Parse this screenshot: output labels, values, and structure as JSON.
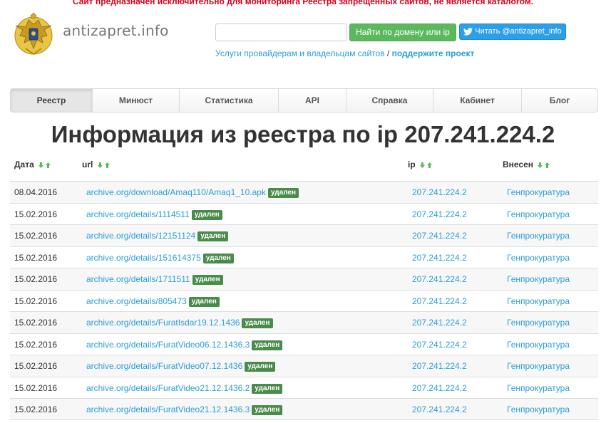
{
  "header": {
    "notice": "Сайт предназначен исключительно для мониторинга Реестра запрещенных сайтов, не является каталогом.",
    "site_name": "antizapret.info",
    "search_placeholder": "",
    "search_button": "Найти по домену или ip",
    "twitter_button": "Читать @antizapret_info",
    "services_link": "Услуги провайдерам и владельцам сайтов",
    "separator": " / ",
    "support_link": "поддержите проект"
  },
  "nav": {
    "tabs": [
      {
        "label": "Реестр",
        "active": true
      },
      {
        "label": "Минюст",
        "active": false
      },
      {
        "label": "Статистика",
        "active": false
      },
      {
        "label": "API",
        "active": false
      },
      {
        "label": "Справка",
        "active": false
      },
      {
        "label": "Кабинет",
        "active": false
      },
      {
        "label": "Блог",
        "active": false
      }
    ]
  },
  "page": {
    "title": "Информация из реестра по ip ",
    "ip": "207.241.224.2"
  },
  "table": {
    "headers": {
      "date": "Дата",
      "url": "url",
      "ip": "ip",
      "added_by": "Внесен"
    },
    "status_label": "удален",
    "rows": [
      {
        "date": "08.04.2016",
        "url": "archive.org/download/Amaq110/Amaq1_10.apk",
        "ip": "207.241.224.2",
        "added_by": "Генпрокуратура"
      },
      {
        "date": "15.02.2016",
        "url": "archive.org/details/1114511",
        "ip": "207.241.224.2",
        "added_by": "Генпрокуратура"
      },
      {
        "date": "15.02.2016",
        "url": "archive.org/details/12151124",
        "ip": "207.241.224.2",
        "added_by": "Генпрокуратура"
      },
      {
        "date": "15.02.2016",
        "url": "archive.org/details/151614375",
        "ip": "207.241.224.2",
        "added_by": "Генпрокуратура"
      },
      {
        "date": "15.02.2016",
        "url": "archive.org/details/1711511",
        "ip": "207.241.224.2",
        "added_by": "Генпрокуратура"
      },
      {
        "date": "15.02.2016",
        "url": "archive.org/details/805473",
        "ip": "207.241.224.2",
        "added_by": "Генпрокуратура"
      },
      {
        "date": "15.02.2016",
        "url": "archive.org/details/FuratIsdar19.12.1436",
        "ip": "207.241.224.2",
        "added_by": "Генпрокуратура"
      },
      {
        "date": "15.02.2016",
        "url": "archive.org/details/FuratVideo06.12.1436.3",
        "ip": "207.241.224.2",
        "added_by": "Генпрокуратура"
      },
      {
        "date": "15.02.2016",
        "url": "archive.org/details/FuratVideo07.12.1436",
        "ip": "207.241.224.2",
        "added_by": "Генпрокуратура"
      },
      {
        "date": "15.02.2016",
        "url": "archive.org/details/FuratVideo21.12.1436.2",
        "ip": "207.241.224.2",
        "added_by": "Генпрокуратура"
      },
      {
        "date": "15.02.2016",
        "url": "archive.org/details/FuratVideo21.12.1436.3",
        "ip": "207.241.224.2",
        "added_by": "Генпрокуратура"
      }
    ]
  },
  "colors": {
    "accent_green": "#5cb85c",
    "twitter_blue": "#2b9fe7",
    "link_blue": "#2a9ed8",
    "notice_red": "#d0021b",
    "badge_green": "#4a8a4a"
  },
  "icons": {
    "logo": "eagle-emblem-icon",
    "twitter": "twitter-bird-icon",
    "sort_down": "sort-down-arrow-icon",
    "sort_up": "sort-up-arrow-icon"
  }
}
